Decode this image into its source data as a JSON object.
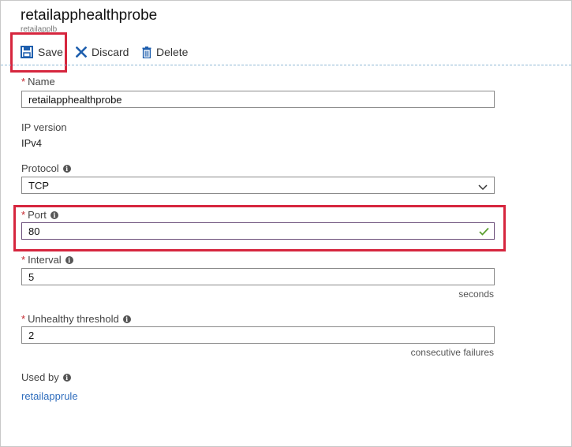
{
  "header": {
    "title": "retailapphealthprobe",
    "subtitle": "retailapplb"
  },
  "toolbar": {
    "save_label": "Save",
    "discard_label": "Discard",
    "delete_label": "Delete",
    "icons": {
      "save": "save-icon",
      "discard": "close-icon",
      "delete": "trash-icon"
    }
  },
  "form": {
    "name": {
      "label": "Name",
      "required": "*",
      "value": "retailapphealthprobe"
    },
    "ip_version": {
      "label": "IP version",
      "value": "IPv4"
    },
    "protocol": {
      "label": "Protocol",
      "selected": "TCP"
    },
    "port": {
      "label": "Port",
      "required": "*",
      "value": "80"
    },
    "interval": {
      "label": "Interval",
      "required": "*",
      "value": "5",
      "unit": "seconds"
    },
    "unhealthy_threshold": {
      "label": "Unhealthy threshold",
      "required": "*",
      "value": "2",
      "unit": "consecutive failures"
    },
    "used_by": {
      "label": "Used by",
      "link": "retailapprule"
    }
  },
  "colors": {
    "highlight": "#d6263e",
    "accent": "#2f6dbd",
    "required": "#c4262e",
    "valid_check": "#5a9e2f"
  }
}
